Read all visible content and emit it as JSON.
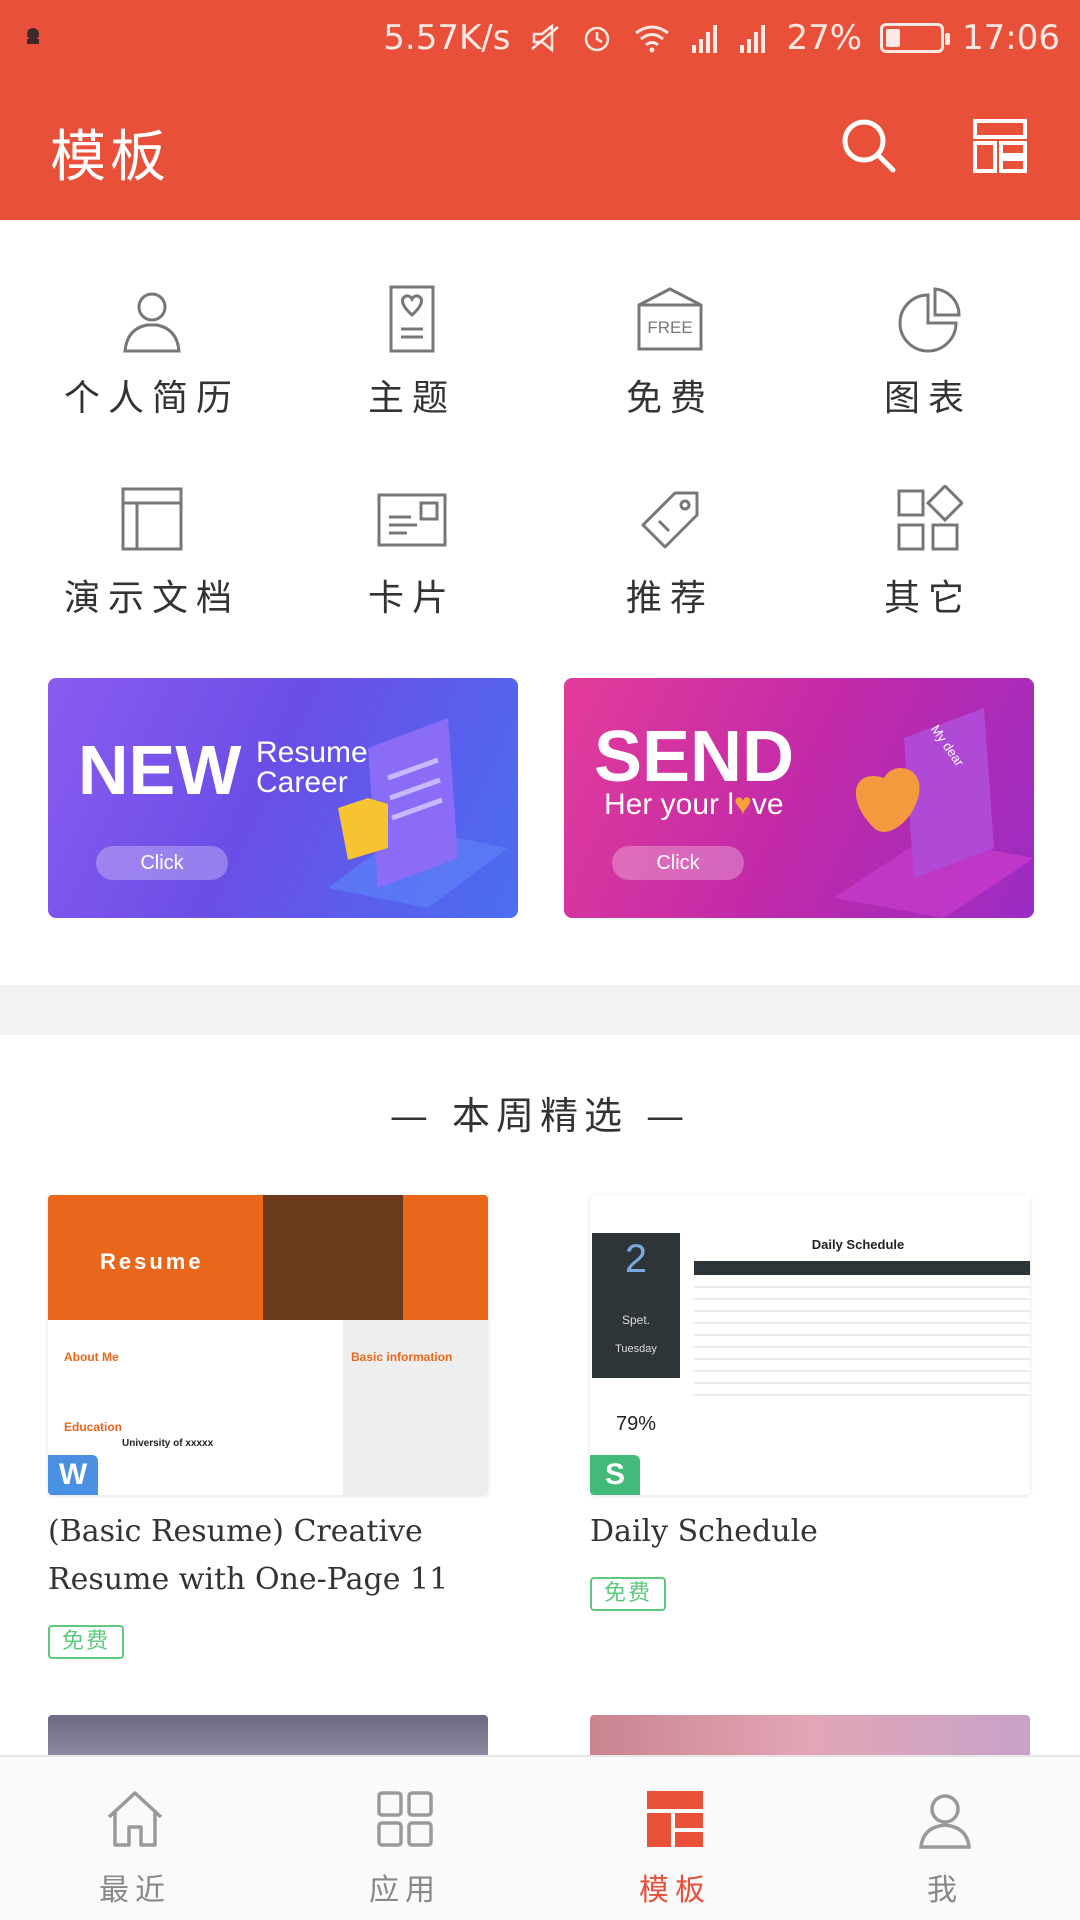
{
  "status_bar": {
    "network_speed": "5.57K/s",
    "battery_percent": "27%",
    "battery_level": 0.27,
    "time": "17:06"
  },
  "header": {
    "title": "模板"
  },
  "categories": [
    {
      "label": "个人简历",
      "icon": "person-icon"
    },
    {
      "label": "主题",
      "icon": "theme-icon"
    },
    {
      "label": "免费",
      "icon": "free-tag-icon",
      "icon_text": "FREE"
    },
    {
      "label": "图表",
      "icon": "pie-chart-icon"
    },
    {
      "label": "演示文档",
      "icon": "presentation-icon"
    },
    {
      "label": "卡片",
      "icon": "card-icon"
    },
    {
      "label": "推荐",
      "icon": "tag-icon"
    },
    {
      "label": "其它",
      "icon": "more-apps-icon"
    }
  ],
  "banners": [
    {
      "big": "NEW",
      "line1": "Resume",
      "line2": "Career",
      "button": "Click"
    },
    {
      "big": "SEND",
      "line1": "Her your l",
      "line1_heart": "♥",
      "line1_end": "ve",
      "button": "Click",
      "note": "My dear"
    }
  ],
  "section": {
    "title": "— 本周精选 —"
  },
  "templates": [
    {
      "title_line1": "(Basic Resume) Creative",
      "title_line2": "Resume with One-Page 11",
      "badge": "免费",
      "app": "W",
      "preview": {
        "heading": "Resume",
        "about": "About Me",
        "education": "Education",
        "basic_info": "Basic information",
        "school": "University of xxxxx"
      }
    },
    {
      "title": "Daily Schedule",
      "badge": "免费",
      "app": "S",
      "preview": {
        "heading": "Daily Schedule",
        "day": "2",
        "month": "Spet.",
        "weekday": "Tuesday",
        "rate": "79%"
      }
    }
  ],
  "bottom_nav": [
    {
      "label": "最近",
      "icon": "home-icon",
      "active": false
    },
    {
      "label": "应用",
      "icon": "apps-grid-icon",
      "active": false
    },
    {
      "label": "模板",
      "icon": "template-icon",
      "active": true
    },
    {
      "label": "我",
      "icon": "profile-icon",
      "active": false
    }
  ],
  "colors": {
    "accent": "#e8503a",
    "free_green": "#5dc97d",
    "word_blue": "#4a90e2",
    "sheet_green": "#43b97a"
  }
}
